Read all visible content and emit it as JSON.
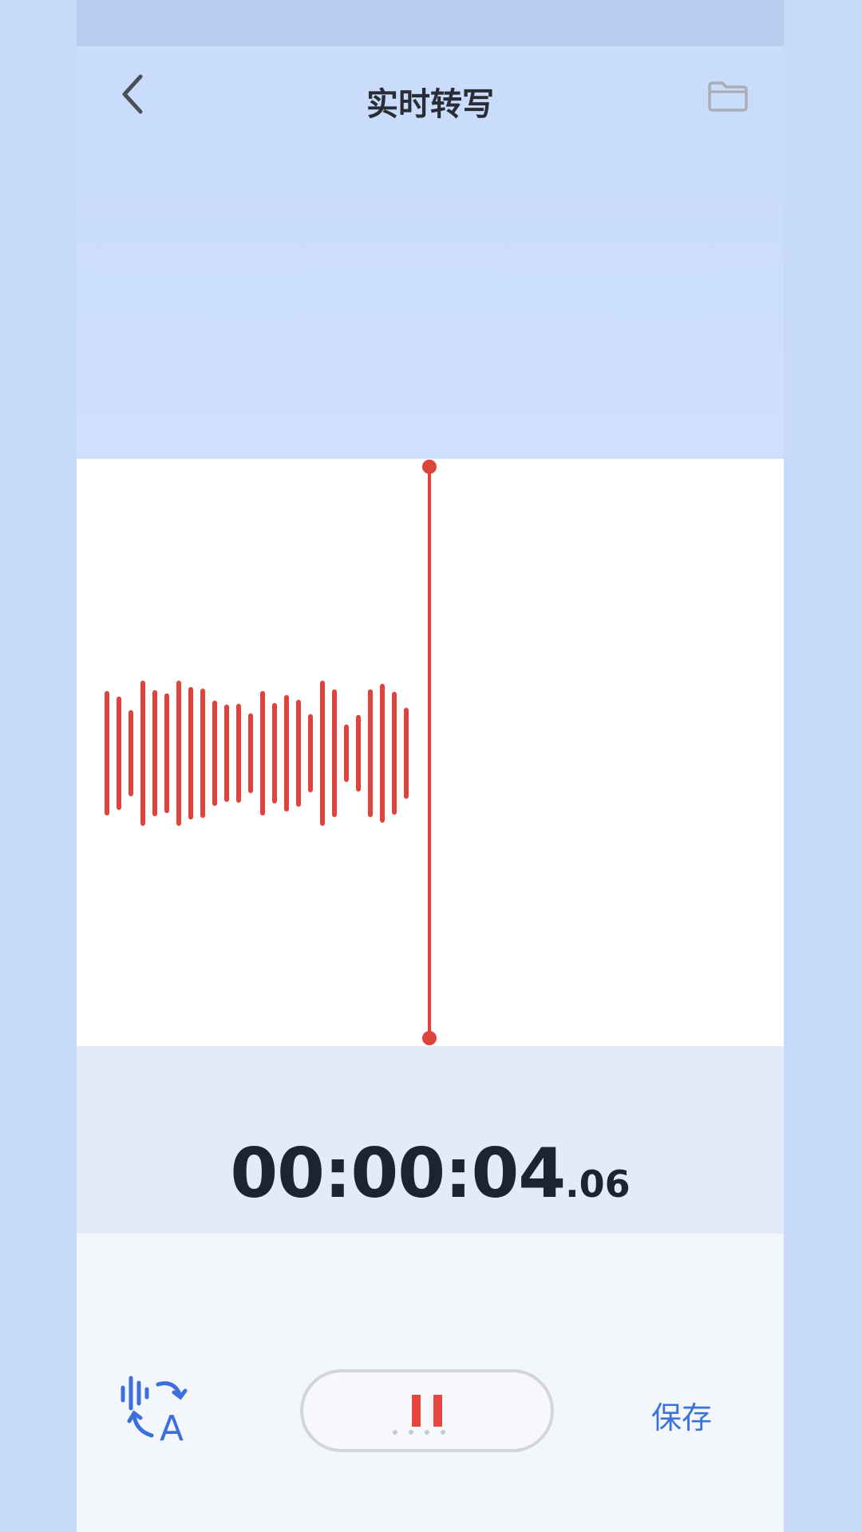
{
  "header": {
    "title": "实时转写",
    "back_icon": "chevron-left-icon",
    "folder_icon": "folder-icon"
  },
  "timer": {
    "main": "00:00:04",
    "fraction": ".06"
  },
  "controls": {
    "transcribe_icon": "voice-to-text-icon",
    "pause_icon": "pause-icon",
    "save_label": "保存"
  },
  "colors": {
    "accent": "#3b73d8",
    "record_red": "#e0433b",
    "background": "#c9dcfb"
  }
}
